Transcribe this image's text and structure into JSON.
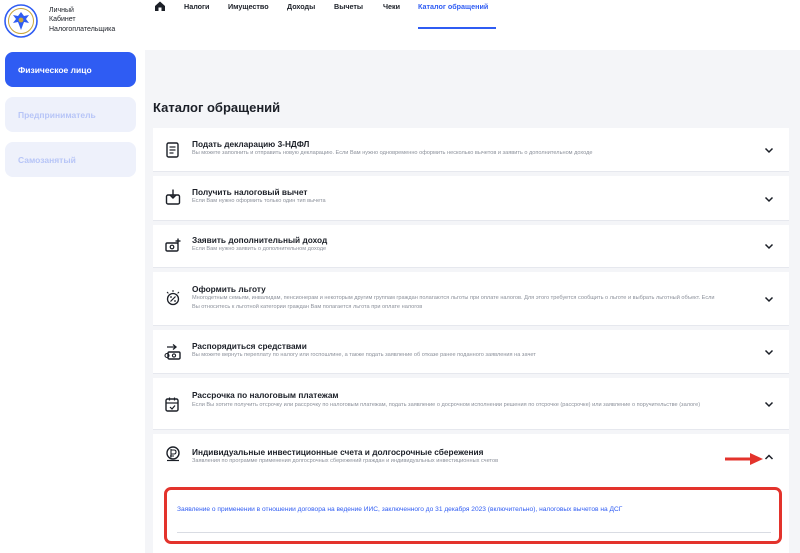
{
  "app": {
    "logo_lines": [
      "Личный",
      "Кабинет",
      "Налогоплательщика"
    ],
    "logo_icon": "eagle-emblem-icon"
  },
  "sidebar": {
    "items": [
      {
        "label": "Физическое лицо",
        "state": "active"
      },
      {
        "label": "Предприниматель",
        "state": "inactive"
      },
      {
        "label": "Самозанятый",
        "state": "inactive"
      }
    ]
  },
  "nav": {
    "home_icon": "home-icon",
    "items": [
      {
        "label": "Налоги"
      },
      {
        "label": "Имущество"
      },
      {
        "label": "Доходы"
      },
      {
        "label": "Вычеты"
      },
      {
        "label": "Чеки"
      },
      {
        "label": "Каталог обращений",
        "current": true
      }
    ]
  },
  "page": {
    "title": "Каталог обращений"
  },
  "catalog": [
    {
      "title": "Подать декларацию 3-НДФЛ",
      "description": "Вы можете заполнить и отправить новую декларацию. Если Вам нужно одновременно оформить несколько вычетов и заявить о дополнительном доходе",
      "icon": "document-icon",
      "expanded": false
    },
    {
      "title": "Получить налоговый вычет",
      "description": "Если Вам нужно оформить только один тип вычета",
      "icon": "wallet-download-icon",
      "expanded": false
    },
    {
      "title": "Заявить дополнительный доход",
      "description": "Если Вам нужно заявить о дополнительном доходе",
      "icon": "money-add-icon",
      "expanded": false
    },
    {
      "title": "Оформить льготу",
      "description": "Многодетным семьям, инвалидам, пенсионерам и некоторым другим группам граждан полагаются льготы при оплате налогов. Для этого требуется сообщить о льготе и выбрать льготный объект. Если Вы относитесь к льготной категории граждан Вам полагается льгота при оплате налогов",
      "icon": "percent-sparkle-icon",
      "expanded": false
    },
    {
      "title": "Распорядиться средствами",
      "description": "Вы можете вернуть переплату по налогу или госпошлине, а также подать заявление об отказе ранее поданного заявления на зачет",
      "icon": "money-transfer-icon",
      "expanded": false
    },
    {
      "title": "Рассрочка по налоговым платежам",
      "description": "Если Вы хотите получить отсрочку или рассрочку по налоговым платежам, подать заявление о досрочном исполнении решения по отсрочке (рассрочке) или заявление о поручительстве (залоге)",
      "icon": "calendar-installment-icon",
      "expanded": false
    },
    {
      "title": "Индивидуальные инвестиционные счета и долгосрочные сбережения",
      "description": "Заявления по программе применения долгосрочных сбережений граждан и индивидуальных инвестиционных счетов",
      "icon": "investment-coin-icon",
      "expanded": true,
      "links": [
        "Заявление о применении в отношении договора на ведение ИИС, заключенного до 31 декабря 2023 (включительно), налоговых вычетов на ДСГ"
      ]
    }
  ],
  "colors": {
    "accent": "#2f5cf3",
    "highlight_frame": "#e3332c",
    "sidebar_inactive_bg": "#eef1fb",
    "page_bg": "#f4f5f8"
  }
}
